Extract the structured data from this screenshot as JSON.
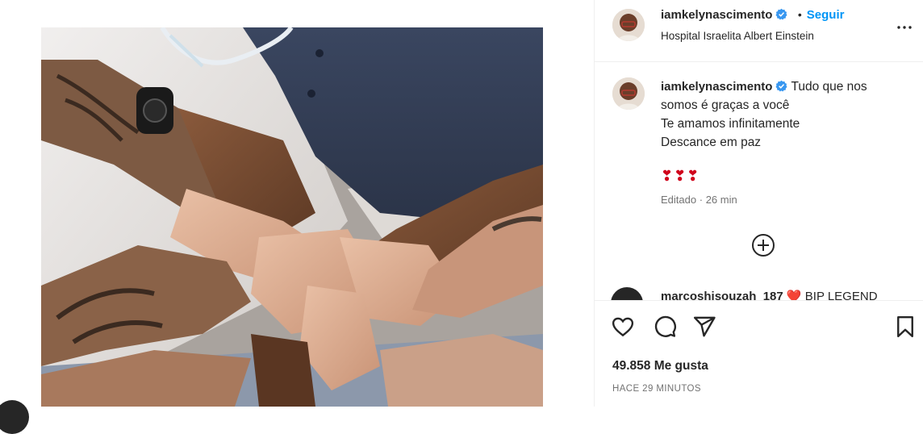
{
  "post": {
    "image_alt": "Hands stacked together over a hospital bed",
    "author": {
      "username": "iamkelynascimento",
      "verified": true,
      "follow_separator": "•",
      "follow_label": "Seguir",
      "location": "Hospital Israelita Albert Einstein"
    },
    "caption": {
      "username": "iamkelynascimento",
      "lines": [
        "Tudo que nos",
        "somos é graças a você",
        "Te amamos infinitamente",
        "Descance em paz"
      ],
      "emojis": "❣❣❣",
      "edited": "Editado",
      "separator": "·",
      "age": "26 min"
    },
    "next_comment": {
      "username": "marcoshisouzah_187",
      "text": "❤️ BIP LEGEND"
    },
    "actions": {
      "like_icon": "heart-icon",
      "comment_icon": "comment-icon",
      "share_icon": "share-icon",
      "save_icon": "bookmark-icon"
    },
    "likes": "49.858 Me gusta",
    "posted": "HACE 29 MINUTOS"
  },
  "colors": {
    "accent": "#0095f6",
    "verified": "#3897f0",
    "heart": "#d0021b",
    "muted": "#737373"
  }
}
